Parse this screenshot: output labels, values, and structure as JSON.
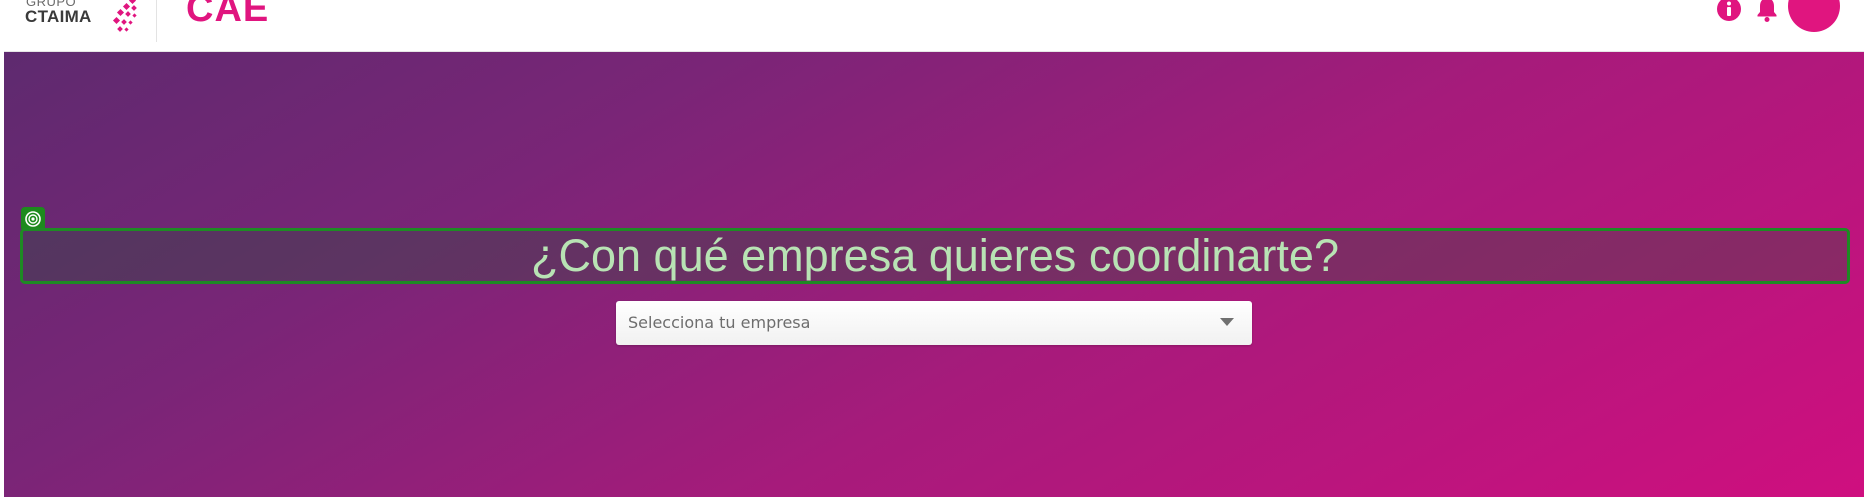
{
  "header": {
    "logo_top": "GRUPO",
    "logo_main": "CTAIMA",
    "app_title": "CAE",
    "icons": [
      "info-icon",
      "bell-icon",
      "user-avatar"
    ],
    "brand_color": "#e0157f"
  },
  "hero": {
    "title": "¿Con qué empresa quieres coordinarte?",
    "select": {
      "placeholder": "Selecciona tu empresa",
      "icon": "chevron-down-icon"
    },
    "gradient_start": "#5e2a6f",
    "gradient_end": "#cf0f7f",
    "title_color": "#b8e3b4"
  }
}
